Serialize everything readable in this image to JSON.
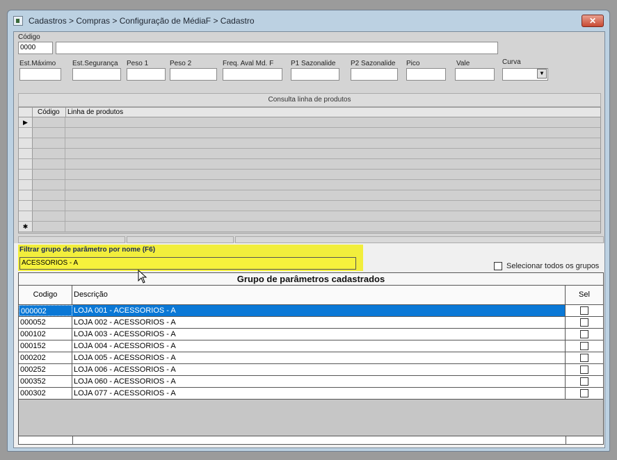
{
  "window": {
    "title": "Cadastros > Compras > Configuração de MédiaF > Cadastro",
    "close_label": "✕"
  },
  "form": {
    "codigo_label": "Código",
    "codigo_value": "0000",
    "descricao_value": "",
    "fields": [
      {
        "label": "Est.Máximo",
        "value": ""
      },
      {
        "label": "Est.Segurança",
        "value": ""
      },
      {
        "label": "Peso 1",
        "value": ""
      },
      {
        "label": "Peso 2",
        "value": ""
      },
      {
        "label": "Freq. Aval Md. F",
        "value": ""
      },
      {
        "label": "P1 Sazonalide",
        "value": ""
      },
      {
        "label": "P2 Sazonalide",
        "value": ""
      },
      {
        "label": "Pico",
        "value": ""
      },
      {
        "label": "Vale",
        "value": ""
      },
      {
        "label": "Curva",
        "value": ""
      }
    ]
  },
  "product_lines": {
    "title": "Consulta linha de produtos",
    "columns": [
      "Código",
      "Linha de produtos"
    ],
    "row_indicator_current": "▶",
    "row_indicator_new": "✱"
  },
  "filter": {
    "label": "Filtrar grupo de parâmetro por nome (F6)",
    "value": "ACESSORIOS - A",
    "select_all_label": "Selecionar todos os grupos"
  },
  "groups": {
    "title": "Grupo de parâmetros cadastrados",
    "columns": [
      "Codigo",
      "Descrição",
      "Sel"
    ],
    "rows": [
      {
        "codigo": "000002",
        "descricao": "LOJA 001 - ACESSORIOS - A",
        "selected": true
      },
      {
        "codigo": "000052",
        "descricao": "LOJA 002 - ACESSORIOS - A",
        "selected": false
      },
      {
        "codigo": "000102",
        "descricao": "LOJA 003 - ACESSORIOS - A",
        "selected": false
      },
      {
        "codigo": "000152",
        "descricao": "LOJA 004 - ACESSORIOS - A",
        "selected": false
      },
      {
        "codigo": "000202",
        "descricao": "LOJA 005 - ACESSORIOS - A",
        "selected": false
      },
      {
        "codigo": "000252",
        "descricao": "LOJA 006 - ACESSORIOS - A",
        "selected": false
      },
      {
        "codigo": "000352",
        "descricao": "LOJA 060 - ACESSORIOS - A",
        "selected": false
      },
      {
        "codigo": "000302",
        "descricao": "LOJA 077 - ACESSORIOS - A",
        "selected": false
      }
    ]
  }
}
